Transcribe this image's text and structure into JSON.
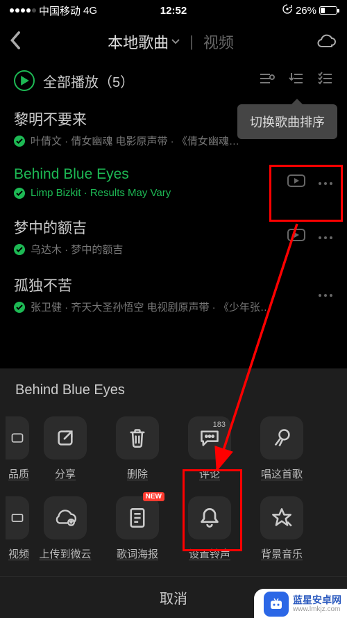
{
  "status": {
    "carrier": "中国移动",
    "net": "4G",
    "time": "12:52",
    "battery": "26%"
  },
  "nav": {
    "tab_active": "本地歌曲",
    "tab_inactive": "视频"
  },
  "playall": {
    "label": "全部播放",
    "count": "（5）"
  },
  "tooltip": "切换歌曲排序",
  "songs": [
    {
      "title": "黎明不要来",
      "sub": "叶倩文 · 倩女幽魂 电影原声带 · 《倩女幽魂…",
      "active": false,
      "show_mv": false
    },
    {
      "title": "Behind Blue Eyes",
      "sub": "Limp Bizkit · Results May Vary",
      "active": true,
      "show_mv": true
    },
    {
      "title": "梦中的额吉",
      "sub": "乌达木 · 梦中的额吉",
      "active": false,
      "show_mv": true
    },
    {
      "title": "孤独不苦",
      "sub": "张卫健 · 齐天大圣孙悟空 电视剧原声带 · 《少年张…",
      "active": false,
      "show_mv": false
    }
  ],
  "sheet": {
    "title": "Behind Blue Eyes",
    "row1": {
      "partial": "品质",
      "items": [
        {
          "key": "share",
          "label": "分享"
        },
        {
          "key": "delete",
          "label": "删除"
        },
        {
          "key": "comment",
          "label": "评论",
          "badge": "183"
        },
        {
          "key": "sing",
          "label": "唱这首歌"
        }
      ]
    },
    "row2": {
      "partial": "视频",
      "items": [
        {
          "key": "upload",
          "label": "上传到微云"
        },
        {
          "key": "lyric",
          "label": "歌词海报",
          "new": true
        },
        {
          "key": "ringtone",
          "label": "设置铃声"
        },
        {
          "key": "bgm",
          "label": "背景音乐"
        }
      ]
    },
    "cancel": "取消"
  },
  "watermark": {
    "name": "蓝星安卓网",
    "url": "www.lmkjz.com"
  }
}
